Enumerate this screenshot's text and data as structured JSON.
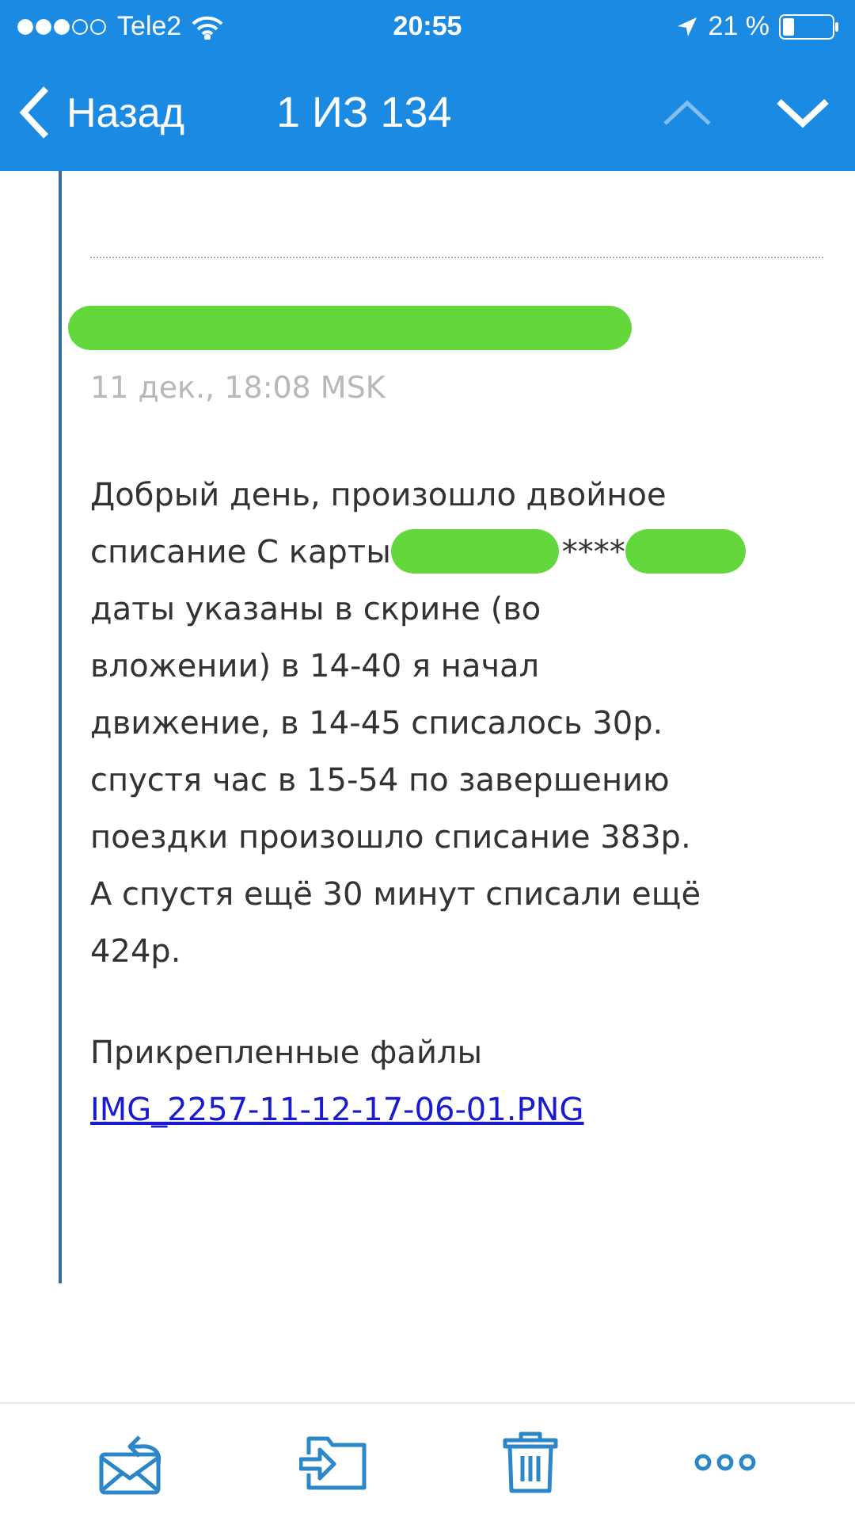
{
  "status_bar": {
    "carrier": "Tele2",
    "time": "20:55",
    "battery": "21 %"
  },
  "nav_bar": {
    "back": "Назад",
    "title": "1 ИЗ 134",
    "prev_disabled": true,
    "next_disabled": false
  },
  "message": {
    "date": "11 дек., 18:08 MSK",
    "body_lines": [
      {
        "kind": "text",
        "text": "Добрый день, произошло двойное"
      },
      {
        "kind": "redacted",
        "before": "списание С карты",
        "middle": "****"
      },
      {
        "kind": "text",
        "text": "даты указаны в скрине (во"
      },
      {
        "kind": "text",
        "text": "вложении) в 14-40 я начал"
      },
      {
        "kind": "text",
        "text": "движение, в 14-45 списалось 30р."
      },
      {
        "kind": "text",
        "text": "спустя час в 15-54 по завершению"
      },
      {
        "kind": "text",
        "text": "поездки произошло списание 383р."
      },
      {
        "kind": "text",
        "text": "А спустя ещё 30 минут списали ещё"
      },
      {
        "kind": "text",
        "text": "424р."
      }
    ],
    "attachments_label": "Прикрепленные файлы",
    "attachment": "IMG_2257-11-12-17-06-01.PNG"
  }
}
